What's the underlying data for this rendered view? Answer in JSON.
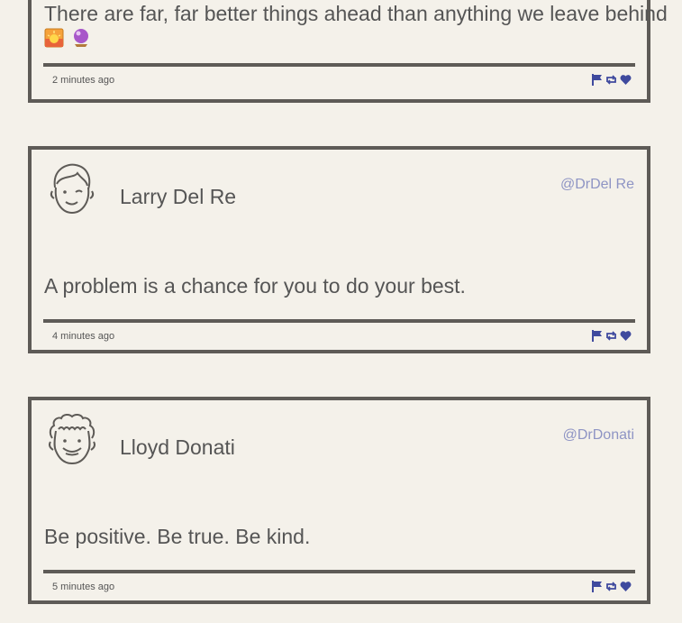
{
  "tweets": [
    {
      "message": "There are far, far better things ahead than anything we leave behind",
      "emojis": [
        "sunrise-emoji",
        "crystal-ball-emoji"
      ],
      "time": "2 minutes ago"
    },
    {
      "name": "Larry Del Re",
      "handle": "@DrDel Re",
      "message": "A problem is a chance for you to do your best.",
      "time": "4 minutes ago"
    },
    {
      "name": "Lloyd Donati",
      "handle": "@DrDonati",
      "message": "Be positive. Be true. Be kind.",
      "time": "5 minutes ago"
    }
  ],
  "colors": {
    "accent": "#3f4a9e",
    "handle": "#8e94c4",
    "border": "#5e5b57",
    "background": "#f4f1ea"
  },
  "icons": [
    "flag-icon",
    "retweet-icon",
    "heart-icon"
  ]
}
